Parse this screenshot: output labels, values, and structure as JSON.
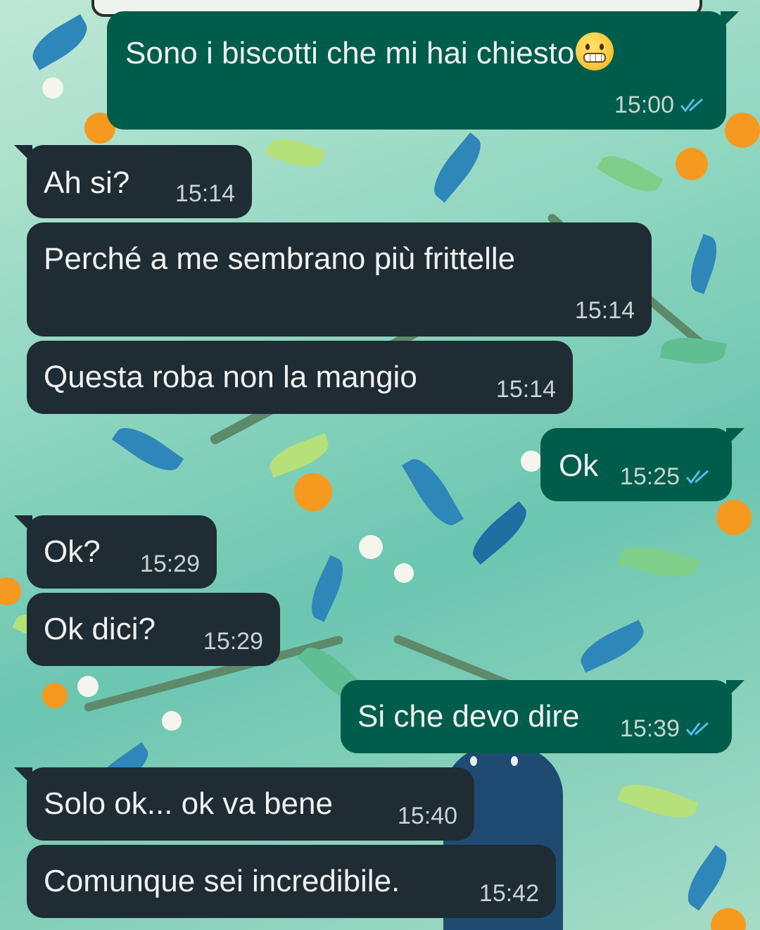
{
  "chat": {
    "messages": [
      {
        "direction": "out",
        "text": "Sono i biscotti che mi hai chiesto",
        "time": "15:00",
        "emoji": "grimacing-face",
        "status": "read"
      },
      {
        "direction": "in",
        "text": "Ah si?",
        "time": "15:14"
      },
      {
        "direction": "in",
        "text": "Perché a me sembrano più frittelle",
        "time": "15:14"
      },
      {
        "direction": "in",
        "text": "Questa roba non la mangio",
        "time": "15:14"
      },
      {
        "direction": "out",
        "text": "Ok",
        "time": "15:25",
        "status": "read"
      },
      {
        "direction": "in",
        "text": "Ok?",
        "time": "15:29"
      },
      {
        "direction": "in",
        "text": "Ok dici?",
        "time": "15:29"
      },
      {
        "direction": "out",
        "text": "Si che devo dire",
        "time": "15:39",
        "status": "read"
      },
      {
        "direction": "in",
        "text": "Solo ok... ok va bene",
        "time": "15:40"
      },
      {
        "direction": "in",
        "text": "Comunque sei incredibile.",
        "time": "15:42"
      }
    ]
  },
  "colors": {
    "incoming_bubble": "#1f2c34",
    "outgoing_bubble": "#005c4b",
    "read_tick": "#53bdeb"
  },
  "icons": {
    "read_receipt": "double-check-icon",
    "emoji": "grimacing-face-emoji"
  }
}
